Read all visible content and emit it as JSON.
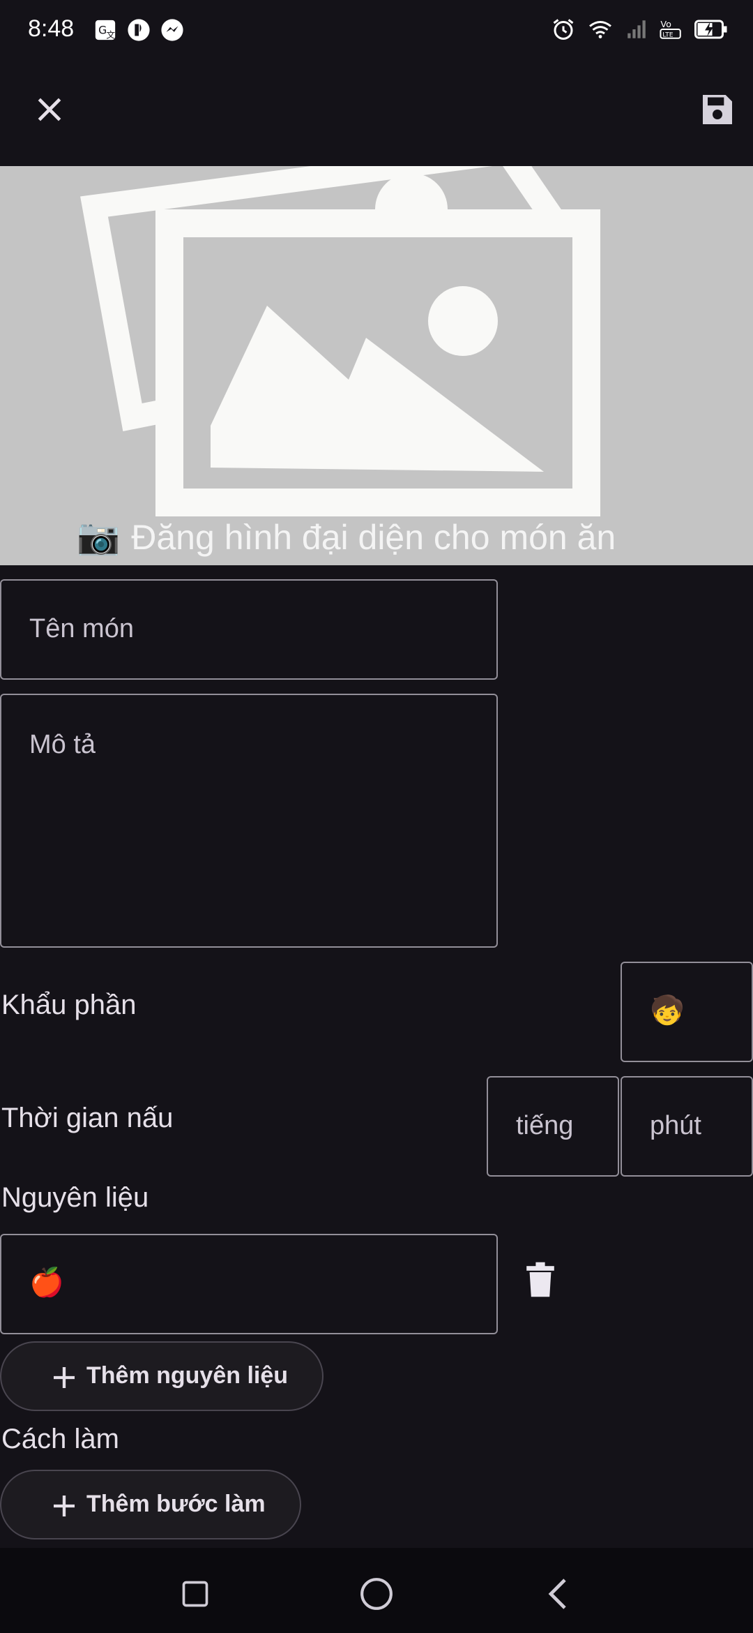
{
  "status_bar": {
    "time": "8:48",
    "left_icons": [
      "translate-icon",
      "notification-icon",
      "messenger-icon"
    ],
    "right_icons": [
      "alarm-icon",
      "wifi-icon",
      "signal-icon",
      "volte-icon",
      "battery-charging-icon"
    ]
  },
  "toolbar": {
    "close_icon": "close-icon",
    "save_icon": "save-icon"
  },
  "hero": {
    "caption": "Đăng hình đại diện cho món ăn",
    "camera_emoji": "📷",
    "image_icon": "image-placeholder-icon"
  },
  "form": {
    "name_placeholder": "Tên món",
    "description_placeholder": "Mô tả",
    "servings_label": "Khẩu phần",
    "servings_emoji": "🧒",
    "cook_time_label": "Thời gian nấu",
    "hours_placeholder": "tiếng",
    "minutes_placeholder": "phút",
    "ingredients_label": "Nguyên liệu",
    "ingredient_emoji": "🍎",
    "add_ingredient": "Thêm nguyên liệu",
    "steps_label": "Cách làm",
    "add_step": "Thêm bước làm"
  },
  "colors": {
    "background": "#141218",
    "hero_bg": "#c4c4c4",
    "outline": "#938f99",
    "text": "#e6e0e9"
  }
}
